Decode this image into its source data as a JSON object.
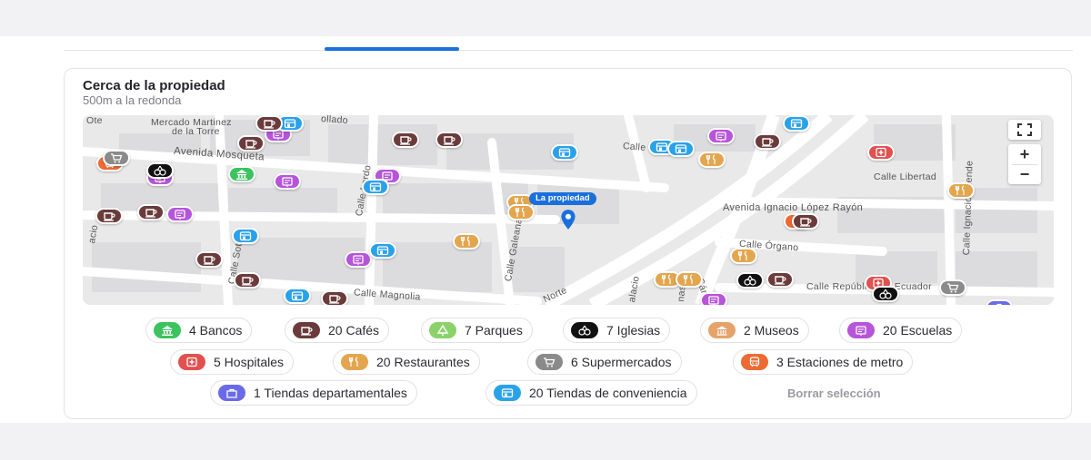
{
  "section": {
    "title": "Cerca de la propiedad",
    "subtitle": "500m a la redonda"
  },
  "map": {
    "property_label": "La propiedad",
    "streets": [
      "Mercado Martinez",
      "de la Torre",
      "Avenida Mosqueta",
      "ollado",
      "Calle",
      "Calle Libertad",
      "Avenida Ignacio López Rayón",
      "Calle Órgano",
      "Calle Lerdo",
      "Calle Galeana",
      "Calle Soto",
      "Calle Magnolia",
      "Norte",
      "Calle Ignacio Allende",
      "Calle República de Ecuador",
      "Cárdenas",
      "alacio",
      "nas",
      "acio",
      "Ote"
    ],
    "zoom_in": "+",
    "zoom_out": "−"
  },
  "categories": [
    {
      "label": "4 Bancos",
      "icon": "bank-icon",
      "color": "#3cc35f"
    },
    {
      "label": "20 Cafés",
      "icon": "coffee-icon",
      "color": "#6b3b3b"
    },
    {
      "label": "7 Parques",
      "icon": "park-icon",
      "color": "#8bd26a"
    },
    {
      "label": "7 Iglesias",
      "icon": "church-icon",
      "color": "#111111"
    },
    {
      "label": "2 Museos",
      "icon": "museum-icon",
      "color": "#e5a36a"
    },
    {
      "label": "20 Escuelas",
      "icon": "school-icon",
      "color": "#b655d9"
    },
    {
      "label": "5 Hospitales",
      "icon": "hospital-icon",
      "color": "#e0514f"
    },
    {
      "label": "20 Restaurantes",
      "icon": "restaurant-icon",
      "color": "#e3a64f"
    },
    {
      "label": "6 Supermercados",
      "icon": "cart-icon",
      "color": "#8a8a8a"
    },
    {
      "label": "3 Estaciones de metro",
      "icon": "metro-icon",
      "color": "#ee6a33"
    },
    {
      "label": "1 Tiendas departamentales",
      "icon": "department-store-icon",
      "color": "#6a6ae8"
    },
    {
      "label": "20 Tiendas de conveniencia",
      "icon": "convenience-store-icon",
      "color": "#2aa2ea"
    }
  ],
  "clear_selection": "Borrar selección"
}
